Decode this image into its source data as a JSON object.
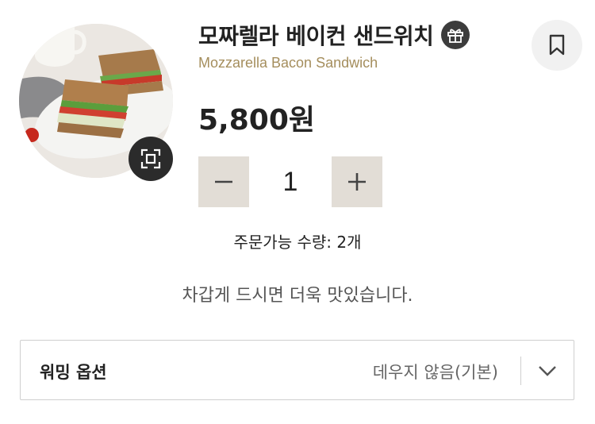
{
  "product": {
    "name_ko": "모짜렐라 베이컨 샌드위치",
    "name_en": "Mozzarella Bacon Sandwich",
    "price": "5,800원"
  },
  "quantity": {
    "value": "1",
    "limit_text": "주문가능 수량: 2개"
  },
  "notice": "차갑게 드시면 더욱 맛있습니다.",
  "warming": {
    "label": "워밍 옵션",
    "selected": "데우지 않음(기본)"
  },
  "icons": {
    "gift": "gift-icon",
    "bookmark": "bookmark-icon",
    "zoom": "expand-icon",
    "minus": "minus-icon",
    "plus": "plus-icon",
    "chevron": "chevron-down-icon"
  },
  "colors": {
    "accent_gold": "#a58e5d",
    "stepper_bg": "#e2ddd6"
  }
}
